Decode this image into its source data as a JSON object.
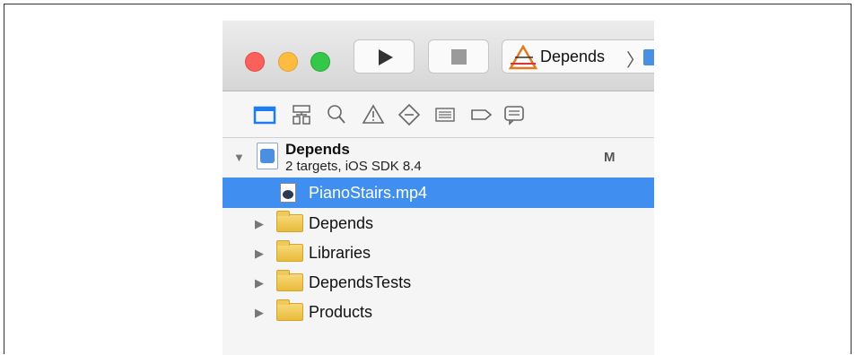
{
  "scheme": {
    "name": "Depends",
    "chevron": "〉"
  },
  "navigator": {
    "icons": [
      "project-navigator-icon",
      "symbol-navigator-icon",
      "find-navigator-icon",
      "issue-navigator-icon",
      "test-navigator-icon",
      "debug-navigator-icon",
      "breakpoint-navigator-icon",
      "report-navigator-icon"
    ],
    "active_color": "#1c7cf4"
  },
  "project": {
    "name": "Depends",
    "subtitle": "2 targets, iOS SDK 8.4",
    "status": "M"
  },
  "tree": {
    "selected_file": "PianoStairs.mp4",
    "folders": [
      "Depends",
      "Libraries",
      "DependsTests",
      "Products"
    ]
  },
  "colors": {
    "selection": "#3f8ef0",
    "folder": "#efc959"
  }
}
